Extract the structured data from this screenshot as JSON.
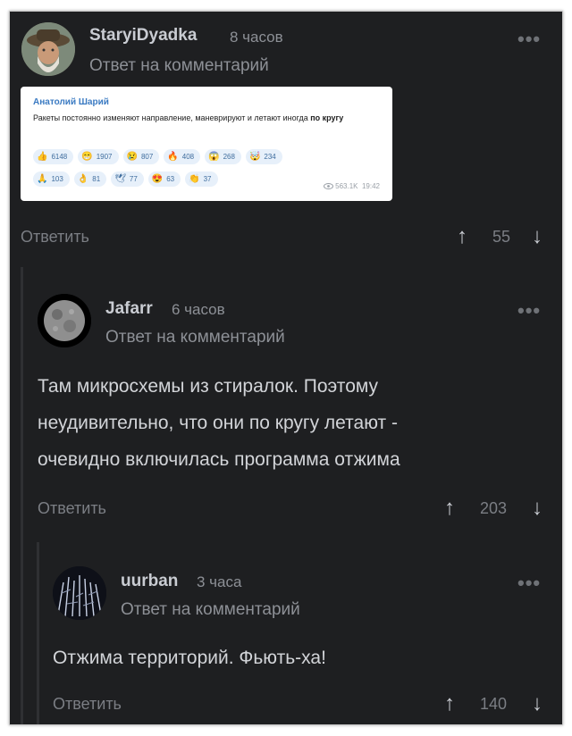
{
  "comments": [
    {
      "author": "StaryiDyadka",
      "time": "8 часов",
      "reply_to": "Ответ на комментарий",
      "more": "•••",
      "reply_label": "Ответить",
      "votes": "55",
      "embedded": {
        "author": "Анатолий Шарий",
        "text_before": "Ракеты постоянно изменяют направление, маневрируют и летают иногда ",
        "text_bold": "по кругу",
        "reactions_row1": [
          {
            "emoji": "👍",
            "count": "6148"
          },
          {
            "emoji": "😁",
            "count": "1907"
          },
          {
            "emoji": "😢",
            "count": "807"
          },
          {
            "emoji": "🔥",
            "count": "408"
          },
          {
            "emoji": "😱",
            "count": "268"
          },
          {
            "emoji": "🤯",
            "count": "234"
          }
        ],
        "reactions_row2": [
          {
            "emoji": "🙏",
            "count": "103"
          },
          {
            "emoji": "👌",
            "count": "81"
          },
          {
            "emoji": "🕊",
            "count": "77"
          },
          {
            "emoji": "😍",
            "count": "63"
          },
          {
            "emoji": "👏",
            "count": "37"
          }
        ],
        "views": "563.1K",
        "posted_time": "19:42"
      }
    },
    {
      "author": "Jafarr",
      "time": "6 часов",
      "reply_to": "Ответ на комментарий",
      "more": "•••",
      "text_lines": [
        "Там микросхемы из стиралок. Поэтому",
        "неудивительно, что они по кругу летают -",
        "очевидно включилась программа отжима"
      ],
      "reply_label": "Ответить",
      "votes": "203"
    },
    {
      "author": "uurban",
      "time": "3 часа",
      "reply_to": "Ответ на комментарий",
      "more": "•••",
      "text": "Отжима территорий. Фьють-ха!",
      "reply_label": "Ответить",
      "votes": "140"
    }
  ],
  "icons": {
    "upvote": "↑",
    "downvote": "↓",
    "eye": "eye-icon"
  },
  "colors": {
    "background": "#1e1f21",
    "link": "#3a7ac2"
  }
}
